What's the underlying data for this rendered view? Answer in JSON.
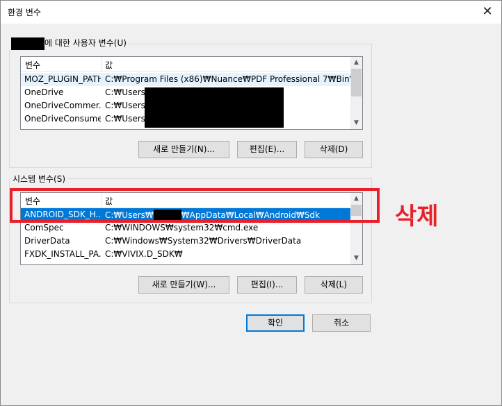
{
  "window": {
    "title": "환경 변수",
    "close_glyph": "✕"
  },
  "user_vars": {
    "group_label": "에 대한 사용자 변수(U)",
    "columns": [
      "변수",
      "값"
    ],
    "rows": [
      {
        "name": "MOZ_PLUGIN_PATH",
        "value": "C:₩Program Files (x86)₩Nuance₩PDF Professional 7₩Bin₩"
      },
      {
        "name": "OneDrive",
        "value": "C:₩Users₩"
      },
      {
        "name": "OneDriveCommer...",
        "value": "C:₩Users₩"
      },
      {
        "name": "OneDriveConsumer",
        "value": "C:₩Users₩"
      }
    ],
    "buttons": {
      "new": "새로 만들기(N)...",
      "edit": "편집(E)...",
      "delete": "삭제(D)"
    }
  },
  "system_vars": {
    "group_label": "시스템 변수(S)",
    "columns": [
      "변수",
      "값"
    ],
    "rows": [
      {
        "name": "ANDROID_SDK_H...",
        "value_prefix": "C:₩Users₩",
        "value_suffix": "₩AppData₩Local₩Android₩Sdk"
      },
      {
        "name": "ComSpec",
        "value": "C:₩WINDOWS₩system32₩cmd.exe"
      },
      {
        "name": "DriverData",
        "value": "C:₩Windows₩System32₩Drivers₩DriverData"
      },
      {
        "name": "FXDK_INSTALL_PA...",
        "value": "C:₩VIVIX.D_SDK₩"
      }
    ],
    "buttons": {
      "new": "새로 만들기(W)...",
      "edit": "편집(I)...",
      "delete": "삭제(L)"
    }
  },
  "dialog_buttons": {
    "ok": "확인",
    "cancel": "취소"
  },
  "annotation": {
    "text": "삭제",
    "color": "#e8202a"
  },
  "colors": {
    "selection": "#0078d7",
    "accent_border": "#0078d7"
  }
}
